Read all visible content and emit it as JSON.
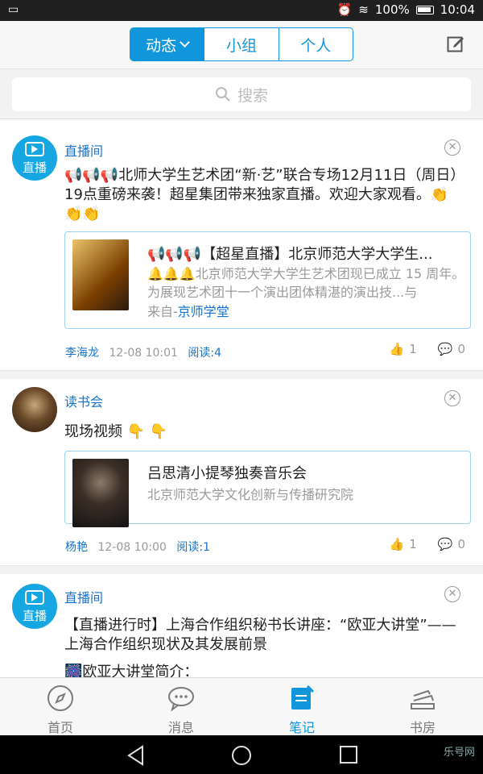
{
  "status_bar": {
    "battery": "100%",
    "time": "10:04"
  },
  "header": {
    "segments": [
      {
        "label": "动态",
        "active": true
      },
      {
        "label": "小组"
      },
      {
        "label": "个人"
      }
    ]
  },
  "search": {
    "placeholder": "搜索"
  },
  "feed": [
    {
      "source": "直播间",
      "avatar_text": "直播",
      "text": "北师大学生艺术团“新·艺”联合专场12月11日（周日）19点重磅来袭！超星集团带来独家直播。欢迎大家观看。",
      "link": {
        "title": "【超星直播】北京师范大学大学生...",
        "desc": "北京师范大学大学生艺术团现已成立 15 周年。为展现艺术团十一个演出团体精湛的演出技...与",
        "from_prefix": "来自-",
        "from": "京师学堂"
      },
      "author": "李海龙",
      "time": "12-08 10:01",
      "reads": "阅读:4",
      "likes": "1",
      "comments": "0"
    },
    {
      "source": "读书会",
      "text": "现场视频",
      "link": {
        "title": "吕思清小提琴独奏音乐会",
        "desc": "北京师范大学文化创新与传播研究院"
      },
      "author": "杨艳",
      "time": "12-08 10:00",
      "reads": "阅读:1",
      "likes": "1",
      "comments": "0"
    },
    {
      "source": "直播间",
      "avatar_text": "直播",
      "text": "【直播进行时】上海合作组织秘书长讲座：“欧亚大讲堂”——上海合作组织现状及其发展前景",
      "text2": "欧亚大讲堂简介："
    }
  ],
  "bottom_tabs": [
    {
      "label": "首页",
      "icon": "compass-icon"
    },
    {
      "label": "消息",
      "icon": "chat-icon"
    },
    {
      "label": "笔记",
      "icon": "note-icon",
      "active": true
    },
    {
      "label": "书房",
      "icon": "bookshelf-icon"
    }
  ],
  "watermark": "乐号网"
}
